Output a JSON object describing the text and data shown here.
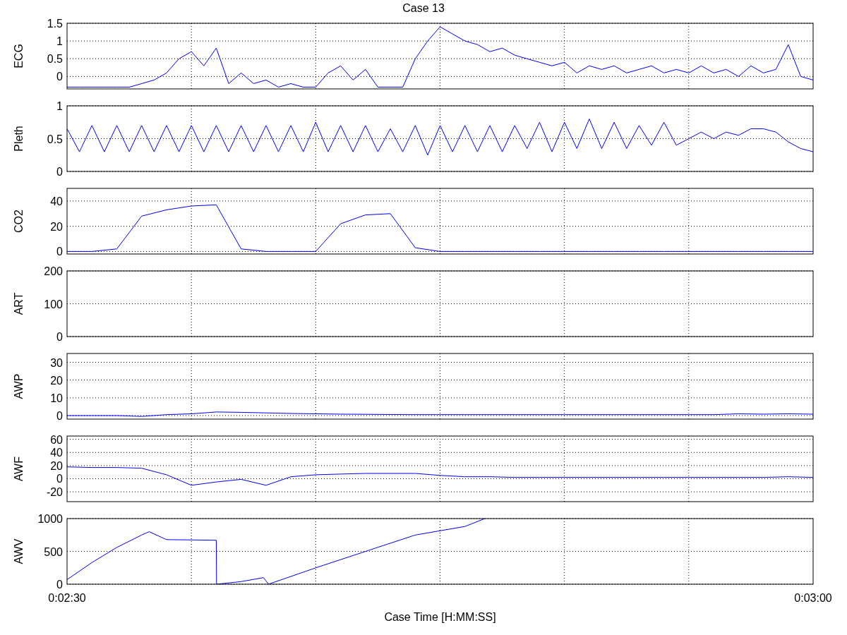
{
  "title": "Case 13",
  "panels": [
    {
      "chart_data": {
        "type": "line",
        "ylabel": "ECG",
        "ylim": [
          -0.35,
          1.5
        ],
        "yticks": [
          0,
          0.5,
          1,
          1.5
        ],
        "grid": true,
        "values": [
          -0.3,
          -0.3,
          -0.3,
          -0.3,
          -0.3,
          -0.3,
          -0.2,
          -0.1,
          0.1,
          0.5,
          0.7,
          0.3,
          0.8,
          -0.2,
          0.1,
          -0.2,
          -0.1,
          -0.3,
          -0.2,
          -0.3,
          -0.3,
          0.1,
          0.3,
          -0.1,
          0.2,
          -0.3,
          -0.3,
          -0.3,
          0.5,
          1.0,
          1.4,
          1.2,
          1.0,
          0.9,
          0.7,
          0.8,
          0.6,
          0.5,
          0.4,
          0.3,
          0.4,
          0.1,
          0.3,
          0.2,
          0.3,
          0.1,
          0.2,
          0.3,
          0.1,
          0.2,
          0.1,
          0.3,
          0.1,
          0.2,
          0.0,
          0.3,
          0.1,
          0.2,
          0.9,
          0.0,
          -0.1
        ]
      }
    },
    {
      "chart_data": {
        "type": "line",
        "ylabel": "Pleth",
        "ylim": [
          0,
          1
        ],
        "yticks": [
          0,
          0.5,
          1
        ],
        "grid": true,
        "values": [
          0.65,
          0.3,
          0.7,
          0.3,
          0.7,
          0.3,
          0.7,
          0.3,
          0.7,
          0.3,
          0.7,
          0.3,
          0.7,
          0.3,
          0.7,
          0.3,
          0.7,
          0.3,
          0.7,
          0.3,
          0.75,
          0.3,
          0.7,
          0.3,
          0.7,
          0.3,
          0.65,
          0.3,
          0.7,
          0.25,
          0.7,
          0.3,
          0.7,
          0.3,
          0.7,
          0.3,
          0.7,
          0.35,
          0.75,
          0.3,
          0.75,
          0.35,
          0.8,
          0.35,
          0.75,
          0.35,
          0.7,
          0.4,
          0.75,
          0.4,
          0.5,
          0.6,
          0.5,
          0.6,
          0.55,
          0.65,
          0.65,
          0.6,
          0.45,
          0.35,
          0.3
        ]
      }
    },
    {
      "chart_data": {
        "type": "line",
        "ylabel": "CO2",
        "ylim": [
          -2,
          50
        ],
        "yticks": [
          0,
          20,
          40
        ],
        "grid": true,
        "values": [
          0,
          0,
          2,
          28,
          33,
          36,
          37,
          2,
          0,
          0,
          0,
          22,
          29,
          30,
          3,
          0,
          0,
          0,
          0,
          0,
          0,
          0,
          0,
          0,
          0,
          0,
          0,
          0,
          0,
          0,
          0
        ]
      }
    },
    {
      "ylabel": "ART",
      "y_tick_labels": [
        "200",
        "100",
        "0"
      ],
      "grid": true
    },
    {
      "chart_data": {
        "type": "line",
        "ylabel": "AWP",
        "ylim": [
          -2,
          35
        ],
        "yticks": [
          0,
          10,
          20,
          30
        ],
        "grid": true,
        "values": [
          0,
          0,
          0,
          -0.5,
          0.5,
          1,
          2,
          1.8,
          1.5,
          1.2,
          1,
          0.8,
          0.7,
          0.6,
          0.5,
          0.5,
          0.5,
          0.5,
          0.5,
          0.5,
          0.5,
          0.5,
          0.5,
          0.5,
          0.5,
          0.5,
          0.5,
          1,
          0.8,
          1,
          0.8
        ]
      }
    },
    {
      "chart_data": {
        "type": "line",
        "ylabel": "AWF",
        "ylim": [
          -35,
          65
        ],
        "yticks": [
          -20,
          0,
          20,
          40,
          60
        ],
        "grid": true,
        "values": [
          18,
          17,
          17,
          16,
          6,
          -10,
          -5,
          -1,
          -10,
          3,
          6,
          7,
          8,
          8,
          8,
          5,
          3,
          3,
          2,
          2,
          2,
          2,
          2,
          2,
          2,
          2,
          2,
          2,
          2,
          3,
          2
        ]
      }
    },
    {
      "chart_data": {
        "type": "line",
        "ylabel": "AWV",
        "xlabel": "Case Time [H:MM:SS]",
        "xlim": [
          150,
          180
        ],
        "ylim": [
          0,
          1000
        ],
        "yticks": [
          0,
          500,
          1000
        ],
        "grid": true,
        "xticks": [
          {
            "value": 150,
            "label": "0:02:30"
          },
          {
            "value": 180,
            "label": "0:03:00"
          }
        ],
        "x": [
          150,
          151,
          152,
          153,
          153.3,
          154,
          156,
          156.01,
          157,
          157.9,
          158.1,
          160,
          162,
          164,
          166,
          166.8
        ],
        "values": [
          70,
          330,
          560,
          750,
          800,
          680,
          670,
          0,
          40,
          100,
          0,
          250,
          500,
          750,
          880,
          1000
        ]
      }
    }
  ]
}
